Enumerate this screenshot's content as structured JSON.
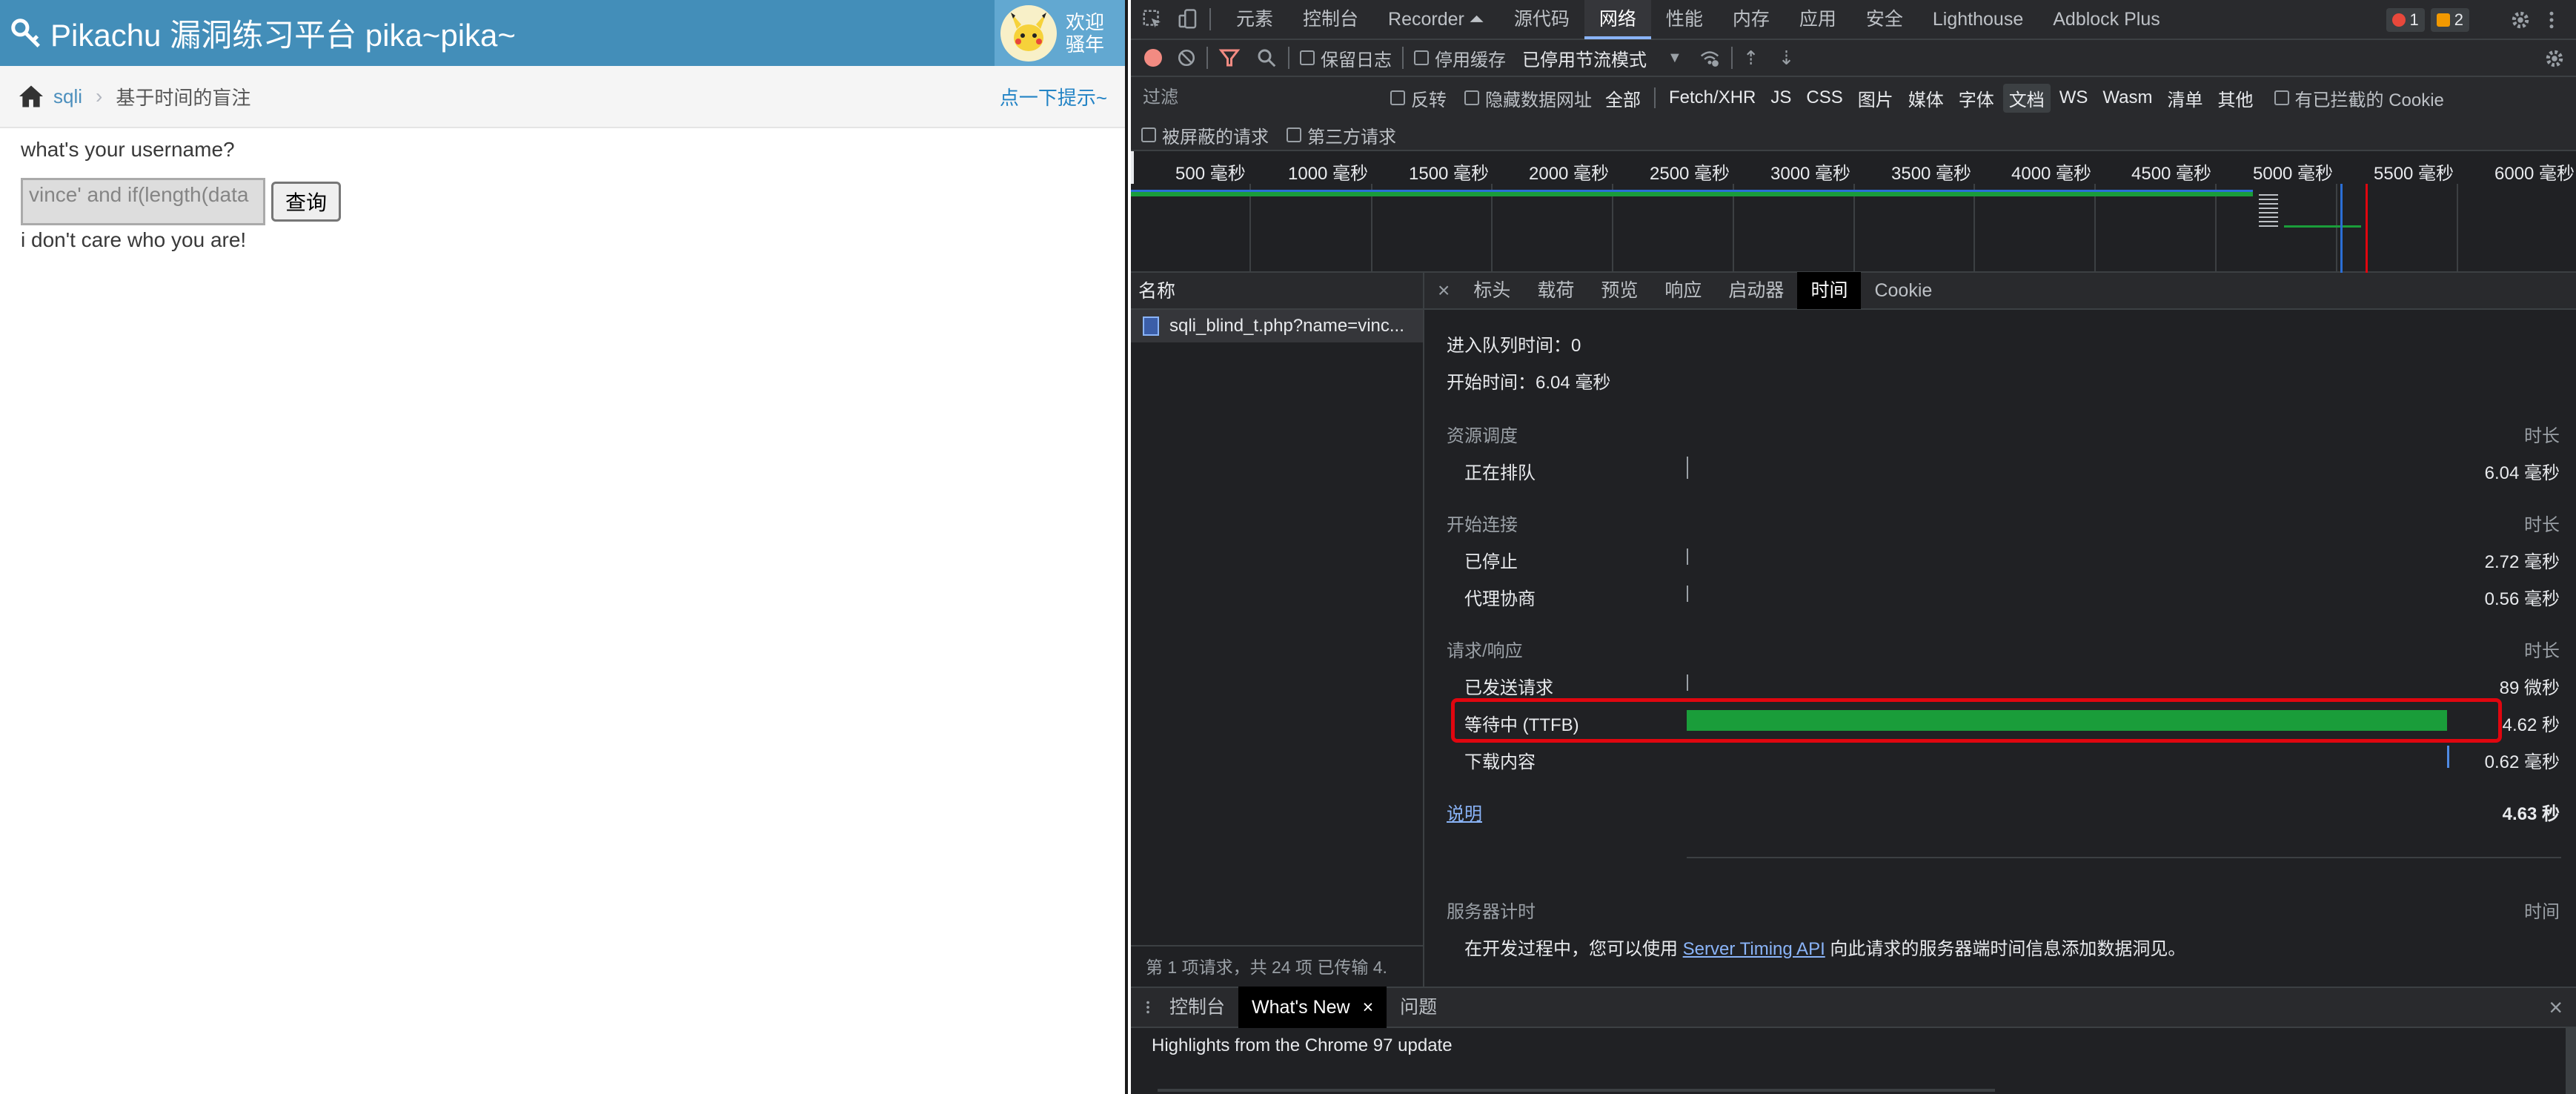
{
  "page": {
    "brand": "Pikachu 漏洞练习平台 pika~pika~",
    "welcome_line1": "欢迎",
    "welcome_line2": "骚年",
    "breadcrumb": {
      "link": "sqli",
      "current": "基于时间的盲注"
    },
    "hint_link": "点一下提示~",
    "question": "what's your username?",
    "input_value": "vince' and if(length(data",
    "submit_label": "查询",
    "result": "i don't care who you are!"
  },
  "devtools": {
    "tabs": [
      "元素",
      "控制台",
      "Recorder ⏶",
      "源代码",
      "网络",
      "性能",
      "内存",
      "应用",
      "安全",
      "Lighthouse",
      "Adblock Plus"
    ],
    "active_tab": "网络",
    "error_count": "1",
    "warning_count": "2",
    "toolbar": {
      "preserve_log": "保留日志",
      "disable_cache": "停用缓存",
      "throttling": "已停用节流模式"
    },
    "filter": {
      "placeholder": "过滤",
      "invert": "反转",
      "hide_data_urls": "隐藏数据网址",
      "types": [
        "全部",
        "Fetch/XHR",
        "JS",
        "CSS",
        "图片",
        "媒体",
        "字体",
        "文档",
        "WS",
        "Wasm",
        "清单",
        "其他"
      ],
      "active_type": "文档",
      "blocked_cookies": "有已拦截的 Cookie",
      "blocked_requests": "被屏蔽的请求",
      "third_party": "第三方请求"
    },
    "overview_ticks": [
      "500 毫秒",
      "1000 毫秒",
      "1500 毫秒",
      "2000 毫秒",
      "2500 毫秒",
      "3000 毫秒",
      "3500 毫秒",
      "4000 毫秒",
      "4500 毫秒",
      "5000 毫秒",
      "5500 毫秒",
      "6000 毫秒"
    ],
    "request_list": {
      "header": "名称",
      "request": "sqli_blind_t.php?name=vinc...",
      "footer": "第 1 项请求，共 24 项    已传输 4."
    },
    "detail_tabs": [
      "标头",
      "载荷",
      "预览",
      "响应",
      "启动器",
      "时间",
      "Cookie"
    ],
    "active_detail_tab": "时间",
    "timing": {
      "queued_at_label": "进入队列时间：0",
      "started_at_label": "开始时间：6.04 毫秒",
      "duration_header": "时长",
      "sections": [
        {
          "title": "资源调度",
          "rows": [
            {
              "label": "正在排队",
              "value": "6.04 毫秒"
            }
          ]
        },
        {
          "title": "开始连接",
          "rows": [
            {
              "label": "已停止",
              "value": "2.72 毫秒"
            },
            {
              "label": "代理协商",
              "value": "0.56 毫秒"
            }
          ]
        },
        {
          "title": "请求/响应",
          "rows": [
            {
              "label": "已发送请求",
              "value": "89 微秒"
            },
            {
              "label": "等待中 (TTFB)",
              "value": "4.62 秒"
            },
            {
              "label": "下载内容",
              "value": "0.62 毫秒"
            }
          ]
        }
      ],
      "explain_link": "说明",
      "total": "4.63 秒",
      "server_timing_title": "服务器计时",
      "server_timing_text_before": "在开发过程中，您可以使用 ",
      "server_timing_link": "Server Timing API",
      "server_timing_text_after": " 向此请求的服务器端时间信息添加数据洞见。"
    },
    "drawer": {
      "tabs": [
        "控制台",
        "What's New",
        "问题"
      ],
      "active_tab": "What's New",
      "highlights": "Highlights from the Chrome 97 update"
    }
  },
  "colors": {
    "topbar": "#438eb9",
    "ttfb_bar": "#1a9d3a",
    "highlight_box": "#e0060f"
  }
}
